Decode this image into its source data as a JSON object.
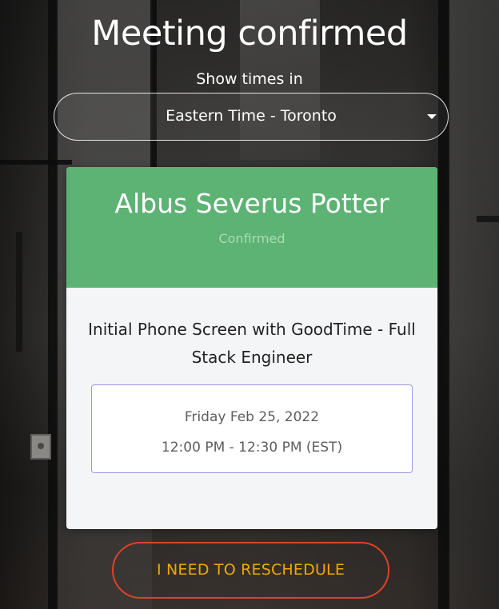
{
  "page": {
    "title": "Meeting confirmed"
  },
  "timezone": {
    "label": "Show times in",
    "selected": "Eastern Time - Toronto"
  },
  "card": {
    "candidate_name": "Albus Severus Potter",
    "status": "Confirmed",
    "meeting_title": "Initial Phone Screen with GoodTime - Full Stack Engineer",
    "date": "Friday Feb 25, 2022",
    "time": "12:00 PM - 12:30 PM (EST)"
  },
  "actions": {
    "reschedule_label": "I NEED TO RESCHEDULE"
  },
  "colors": {
    "header_green": "#5db373",
    "reschedule_border": "#e0412b",
    "reschedule_text": "#f0a800",
    "time_box_border": "#9c98e6"
  },
  "icons": {
    "timezone_dropdown": "caret-down-icon"
  }
}
